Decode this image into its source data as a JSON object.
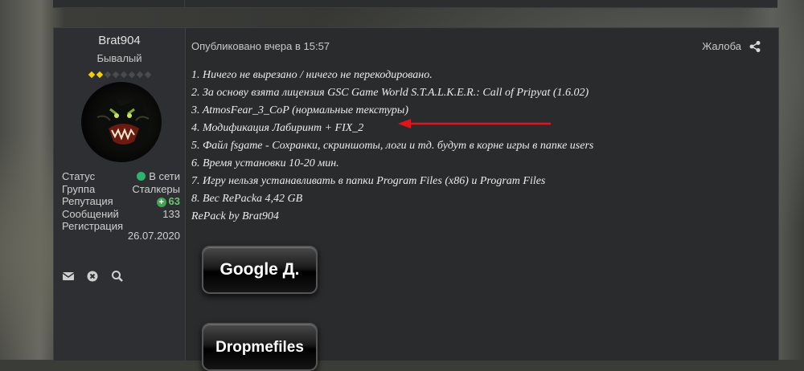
{
  "author": {
    "username": "Brat904",
    "rank": "Бывалый",
    "stats": [
      {
        "key": "Статус",
        "value": "В сети"
      },
      {
        "key": "Группа",
        "value": "Сталкеры"
      },
      {
        "key": "Репутация",
        "value": "63"
      },
      {
        "key": "Сообщений",
        "value": "133"
      },
      {
        "key": "Регистрация",
        "value": "26.07.2020"
      }
    ],
    "rank_pips_filled": 2,
    "rank_pips_total": 8
  },
  "post": {
    "posted": "Опубликовано вчера в 15:57",
    "report_label": "Жалоба",
    "lines": [
      "1. Ничего не вырезано / ничего не перекодировано.",
      "2. За основу взята лицензия GSC Game World S.T.A.L.K.E.R.: Call of Pripyat (1.6.02)",
      "3. AtmosFear_3_CoP (нормальные текстуры)",
      "4. Модификация Лабиринт + FIX_2",
      "5. Файл fsgame - Сохранки, скриншоты, логи и тд. будут в корне игры в папке users",
      "6. Время установки 10-20 мин.",
      "7. Игру нельзя устанавливать в папки Program Files (x86) и Program Files",
      "8. Вес RePacka 4,42 GB",
      "RePack by Brat904"
    ],
    "buttons": {
      "google": "Google Д.",
      "dropmefiles": "Dropmefiles"
    }
  },
  "colors": {
    "online": "#2fb36d",
    "reputation": "#6cc56f",
    "arrow": "#e0141b",
    "pip": "#f5d000"
  }
}
